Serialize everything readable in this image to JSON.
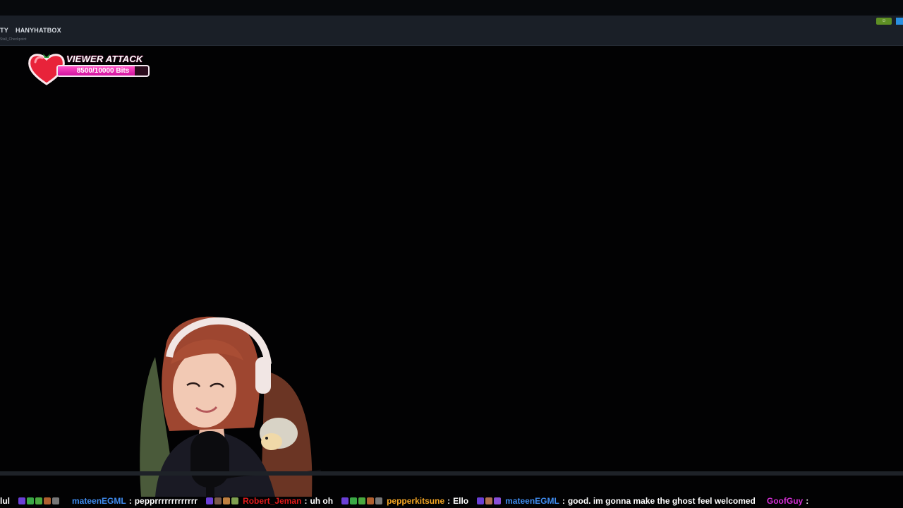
{
  "navbar": {
    "items": [
      "TY",
      "HANYHATBOX"
    ],
    "sub_text": "Stall_Checkpoint"
  },
  "viewer_attack": {
    "title": "VIEWER ATTACK",
    "progress_text": "8500/10000 Bits",
    "current": 8500,
    "goal": 10000,
    "progress_fraction": 0.85,
    "heart_color": "#e8233a",
    "bar_color": "#e62fb0"
  },
  "chat": {
    "messages": [
      {
        "user": "",
        "text": "lul",
        "color": "#ffffff",
        "badges": [
          "#6a3fd6",
          "#3aa845",
          "#4aa83f",
          "#b06030",
          "#777777"
        ]
      },
      {
        "user": "mateenEGML",
        "text": "pepprrrrrrrrrrrrr",
        "color": "#3f8cf0",
        "badges": [
          "#6a3fd6",
          "#c0a0c0",
          "#b040e0",
          "#8060d0"
        ]
      },
      {
        "user": "Robert_Jeman",
        "text": "uh oh",
        "color": "#e41b1b",
        "badges": [
          "#6a3fd6",
          "#7a5a4a",
          "#c08040",
          "#7fa050"
        ]
      },
      {
        "user": "pepperkitsune",
        "text": "Ello",
        "color": "#f5a623",
        "badges": [
          "#6a3fd6",
          "#3aa845",
          "#4aa83f",
          "#b06030",
          "#777777"
        ]
      },
      {
        "user": "mateenEGML",
        "text": "good. im gonna make the ghost feel welcomed",
        "color": "#3f8cf0",
        "badges": [
          "#6a3fd6",
          "#b07050",
          "#8a4fd8"
        ]
      },
      {
        "user": "GoofGuy",
        "text": "",
        "color": "#d62fd6",
        "badges": []
      }
    ]
  }
}
